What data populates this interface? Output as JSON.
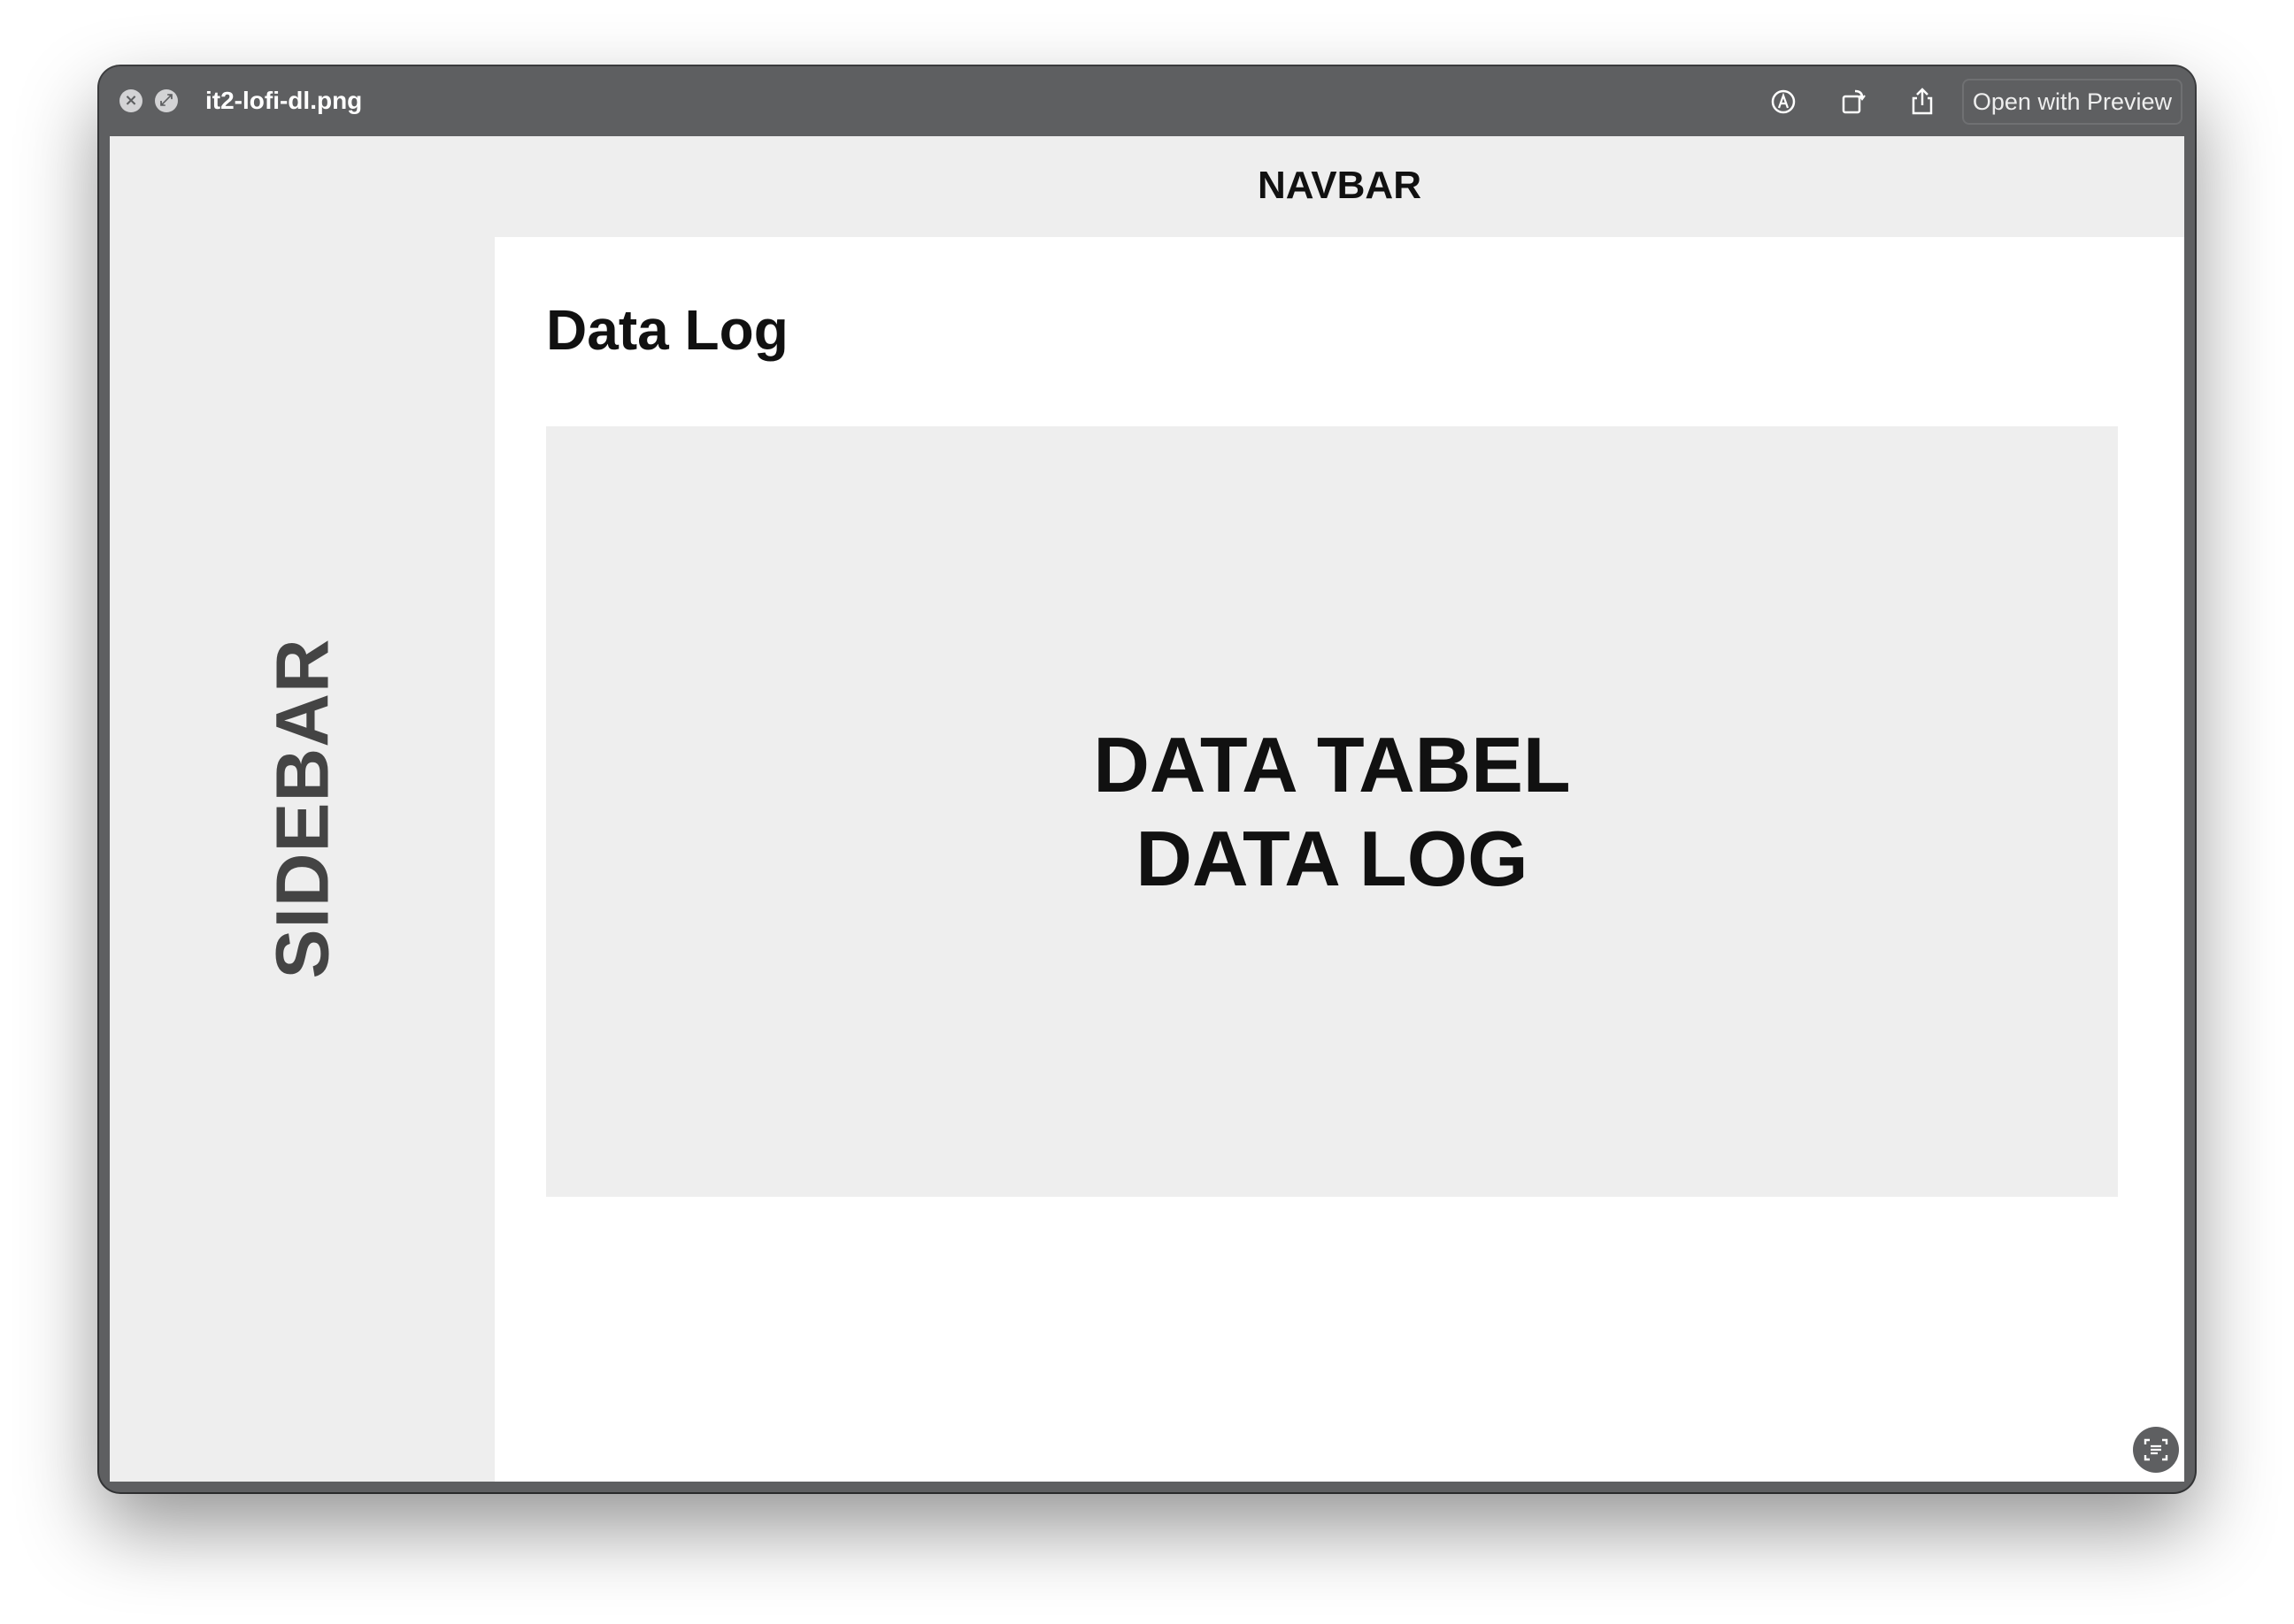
{
  "window": {
    "filename": "it2-lofi-dl.png",
    "open_button_label": "Open with Preview",
    "toolbar_icons": [
      "markup-icon",
      "rotate-icon",
      "share-icon"
    ]
  },
  "wireframe": {
    "navbar_label": "NAVBAR",
    "sidebar_label": "SIDEBAR",
    "page_title": "Data Log",
    "placeholder_line1": "DATA TABEL",
    "placeholder_line2": "DATA LOG"
  },
  "colors": {
    "titlebar": "#5e5f61",
    "placeholder_gray": "#eeeeee",
    "sidebar_text": "#444444",
    "text": "#111111"
  }
}
